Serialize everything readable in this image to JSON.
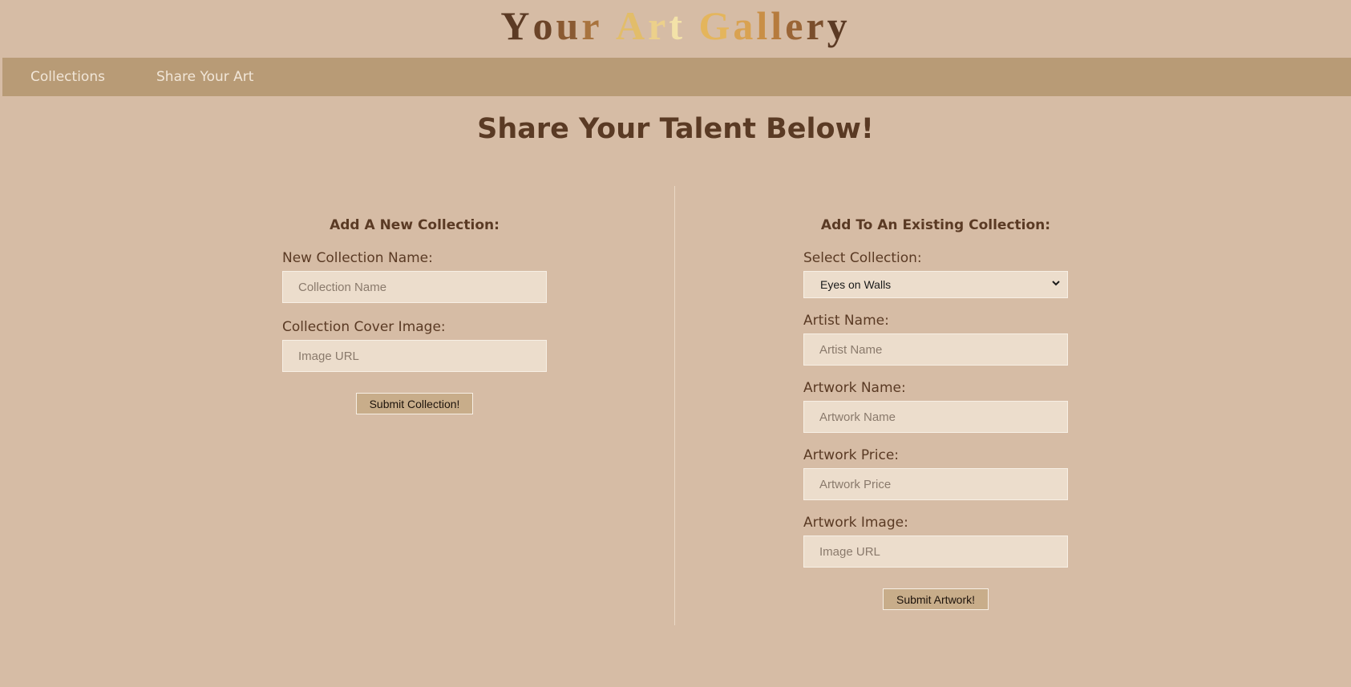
{
  "header": {
    "title_letters": [
      {
        "ch": "Y",
        "color": "#5b3a24"
      },
      {
        "ch": "o",
        "color": "#6b4428"
      },
      {
        "ch": "u",
        "color": "#8a5a32"
      },
      {
        "ch": "r",
        "color": "#a8733e"
      },
      {
        "ch": " ",
        "color": "#000000"
      },
      {
        "ch": "A",
        "color": "#e2bd6a"
      },
      {
        "ch": "r",
        "color": "#ecd08a"
      },
      {
        "ch": "t",
        "color": "#f3e2a8"
      },
      {
        "ch": " ",
        "color": "#000000"
      },
      {
        "ch": "G",
        "color": "#e4b55c"
      },
      {
        "ch": "a",
        "color": "#d9a251"
      },
      {
        "ch": "l",
        "color": "#c98f46"
      },
      {
        "ch": "l",
        "color": "#b67b3d"
      },
      {
        "ch": "e",
        "color": "#9a6536"
      },
      {
        "ch": "r",
        "color": "#7a4e2c"
      },
      {
        "ch": "y",
        "color": "#5b3a24"
      }
    ]
  },
  "nav": {
    "items": [
      {
        "label": "Collections"
      },
      {
        "label": "Share Your Art"
      }
    ]
  },
  "main": {
    "heading": "Share Your Talent Below!"
  },
  "new_collection": {
    "title": "Add A New Collection:",
    "name_label": "New Collection Name:",
    "name_placeholder": "Collection Name",
    "cover_label": "Collection Cover Image:",
    "cover_placeholder": "Image URL",
    "submit_label": "Submit Collection!"
  },
  "existing_collection": {
    "title": "Add To An Existing Collection:",
    "select_label": "Select Collection:",
    "select_value": "Eyes on Walls",
    "artist_label": "Artist Name:",
    "artist_placeholder": "Artist Name",
    "artwork_name_label": "Artwork Name:",
    "artwork_name_placeholder": "Artwork Name",
    "price_label": "Artwork Price:",
    "price_placeholder": "Artwork Price",
    "image_label": "Artwork Image:",
    "image_placeholder": "Image URL",
    "submit_label": "Submit Artwork!"
  },
  "colors": {
    "background": "#d6bca5",
    "navbar": "#b89b76",
    "text": "#5a3a24",
    "input_bg": "#ecddcc"
  }
}
